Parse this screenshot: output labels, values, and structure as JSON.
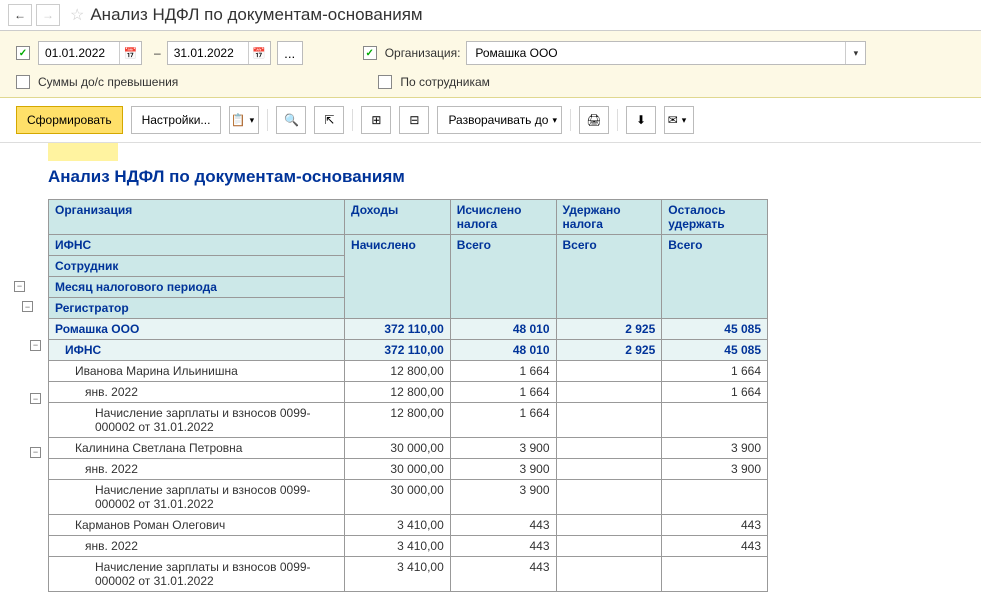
{
  "title": "Анализ НДФЛ по документам-основаниям",
  "dateFrom": "01.01.2022",
  "dateTo": "31.01.2022",
  "orgLabel": "Организация:",
  "orgValue": "Ромашка ООО",
  "sumsLabel": "Суммы до/с превышения",
  "byEmpLabel": "По сотрудникам",
  "toolbar": {
    "form": "Сформировать",
    "settings": "Настройки...",
    "expand": "Разворачивать до"
  },
  "reportTitle": "Анализ НДФЛ по документам-основаниям",
  "hdr": {
    "org": "Организация",
    "income": "Доходы",
    "taxCalc": "Исчислено налога",
    "taxHeld": "Удержано налога",
    "taxLeft": "Осталось удержать",
    "ifns": "ИФНС",
    "accrued": "Начислено",
    "total": "Всего",
    "employee": "Сотрудник",
    "month": "Месяц налогового периода",
    "reg": "Регистратор"
  },
  "rows": [
    {
      "lvl": 0,
      "c1": "Ромашка ООО",
      "c2": "372 110,00",
      "c3": "48 010",
      "c4": "2 925",
      "c5": "45 085",
      "cls": "total-row"
    },
    {
      "lvl": 1,
      "c1": "ИФНС",
      "c2": "372 110,00",
      "c3": "48 010",
      "c4": "2 925",
      "c5": "45 085",
      "cls": "sub1-row"
    },
    {
      "lvl": 2,
      "c1": "Иванова Марина Ильинишна",
      "c2": "12 800,00",
      "c3": "1 664",
      "c4": "",
      "c5": "1 664",
      "cls": "data-row"
    },
    {
      "lvl": 3,
      "c1": "янв. 2022",
      "c2": "12 800,00",
      "c3": "1 664",
      "c4": "",
      "c5": "1 664",
      "cls": "data-row"
    },
    {
      "lvl": 4,
      "c1": "Начисление зарплаты и взносов 0099-000002 от 31.01.2022",
      "c2": "12 800,00",
      "c3": "1 664",
      "c4": "",
      "c5": "",
      "cls": "data-row"
    },
    {
      "lvl": 2,
      "c1": "Калинина Светлана Петровна",
      "c2": "30 000,00",
      "c3": "3 900",
      "c4": "",
      "c5": "3 900",
      "cls": "data-row"
    },
    {
      "lvl": 3,
      "c1": "янв. 2022",
      "c2": "30 000,00",
      "c3": "3 900",
      "c4": "",
      "c5": "3 900",
      "cls": "data-row"
    },
    {
      "lvl": 4,
      "c1": "Начисление зарплаты и взносов 0099-000002 от 31.01.2022",
      "c2": "30 000,00",
      "c3": "3 900",
      "c4": "",
      "c5": "",
      "cls": "data-row"
    },
    {
      "lvl": 2,
      "c1": "Карманов Роман Олегович",
      "c2": "3 410,00",
      "c3": "443",
      "c4": "",
      "c5": "443",
      "cls": "data-row"
    },
    {
      "lvl": 3,
      "c1": "янв. 2022",
      "c2": "3 410,00",
      "c3": "443",
      "c4": "",
      "c5": "443",
      "cls": "data-row"
    },
    {
      "lvl": 4,
      "c1": "Начисление зарплаты и взносов 0099-000002 от 31.01.2022",
      "c2": "3 410,00",
      "c3": "443",
      "c4": "",
      "c5": "",
      "cls": "data-row"
    }
  ]
}
